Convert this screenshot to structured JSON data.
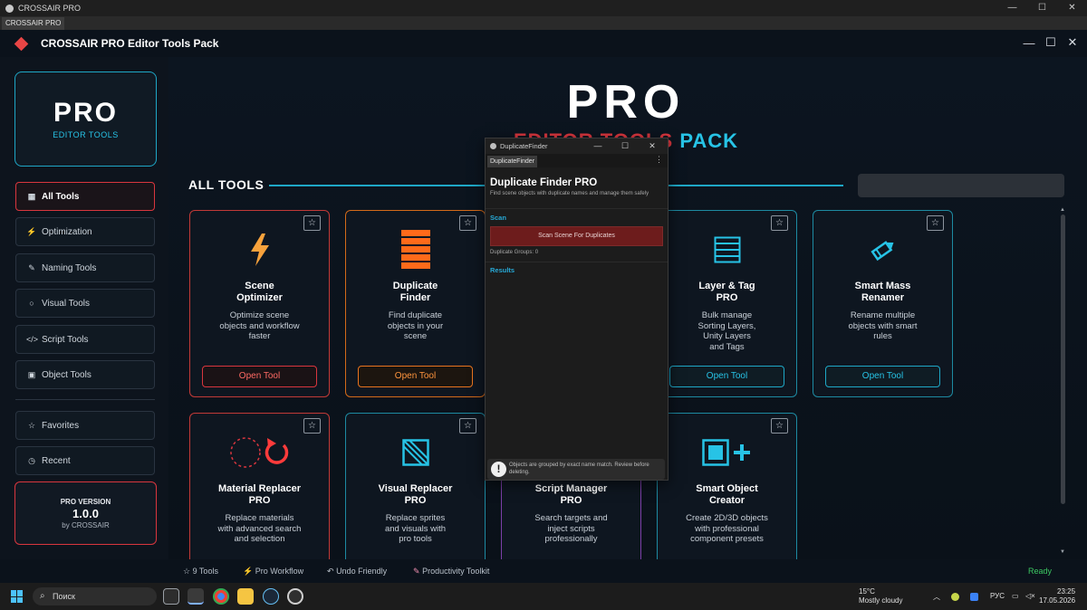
{
  "os_window": {
    "title": "CROSSAIR PRO",
    "tab": "CROSSAIR PRO",
    "controls": [
      "—",
      "☐",
      "✕"
    ]
  },
  "app": {
    "title": "CROSSAIR PRO Editor Tools Pack",
    "window_controls": [
      "—",
      "☐",
      "✕"
    ],
    "brand_color": "#e84545",
    "accent_color": "#27c3e6"
  },
  "sidebar": {
    "logo": {
      "title": "PRO",
      "subtitle": "EDITOR TOOLS"
    },
    "nav": [
      {
        "icon": "▦",
        "icon_name": "grid-icon",
        "label": "All Tools",
        "active": true
      },
      {
        "icon": "⚡",
        "icon_name": "bolt-icon",
        "label": "Optimization",
        "active": false
      },
      {
        "icon": "✎",
        "icon_name": "pencil-icon",
        "label": "Naming Tools",
        "active": false
      },
      {
        "icon": "○",
        "icon_name": "circle-icon",
        "label": "Visual Tools",
        "active": false
      },
      {
        "icon": "</>",
        "icon_name": "code-icon",
        "label": "Script Tools",
        "active": false
      },
      {
        "icon": "▣",
        "icon_name": "cube-icon",
        "label": "Object Tools",
        "active": false
      }
    ],
    "secondary": [
      {
        "icon": "☆",
        "icon_name": "star-icon",
        "label": "Favorites"
      },
      {
        "icon": "◷",
        "icon_name": "clock-icon",
        "label": "Recent"
      }
    ],
    "version": {
      "label": "PRO VERSION",
      "number": "1.0.0",
      "by": "by CROSSAIR"
    }
  },
  "hero": {
    "title": "PRO",
    "subtitle_part1": "EDITOR TOOLS",
    "subtitle_part2": "PACK"
  },
  "tools_section": {
    "heading": "ALL TOOLS",
    "search_value": ""
  },
  "cards": [
    {
      "icon_name": "bolt-icon",
      "title": "Scene\nOptimizer",
      "desc": "Optimize scene\nobjects and workflow\nfaster",
      "button": "Open Tool",
      "theme": "red",
      "star": "☆"
    },
    {
      "icon_name": "stack-icon",
      "title": "Duplicate\nFinder",
      "desc": "Find duplicate\nobjects in your\nscene",
      "button": "Open Tool",
      "theme": "orange",
      "star": "☆"
    },
    {
      "icon_name": "layers-icon",
      "title": "Layer & Tag\nPRO",
      "desc": "Bulk manage\nSorting Layers,\nUnity Layers\nand Tags",
      "button": "Open Tool",
      "theme": "cyan",
      "star": "☆"
    },
    {
      "icon_name": "pencil-icon",
      "title": "Smart Mass\nRenamer",
      "desc": "Rename multiple\nobjects with smart\nrules",
      "button": "Open Tool",
      "theme": "cyan",
      "star": "☆"
    },
    {
      "icon_name": "material-replace-icon",
      "title": "Material Replacer\nPRO",
      "desc": "Replace materials\nwith advanced search\nand selection",
      "button": "",
      "theme": "red",
      "star": "☆"
    },
    {
      "icon_name": "visual-replace-icon",
      "title": "Visual Replacer\nPRO",
      "desc": "Replace sprites\nand visuals with\npro tools",
      "button": "",
      "theme": "cyan",
      "star": "☆"
    },
    {
      "icon_name": "script-icon",
      "title": "Script Manager\nPRO",
      "desc": "Search targets and\ninject scripts\nprofessionally",
      "button": "",
      "theme": "purple",
      "star": ""
    },
    {
      "icon_name": "object-creator-icon",
      "title": "Smart Object\nCreator",
      "desc": "Create 2D/3D objects\nwith professional\ncomponent presets",
      "button": "",
      "theme": "cyan",
      "star": "☆"
    }
  ],
  "footer": {
    "items": [
      {
        "icon": "☆",
        "icon_name": "star-icon",
        "label": "9 Tools"
      },
      {
        "icon": "⚡",
        "icon_name": "bolt-icon",
        "label": "Pro Workflow"
      },
      {
        "icon": "↶",
        "icon_name": "undo-icon",
        "label": "Undo Friendly"
      },
      {
        "icon": "✎",
        "icon_name": "brush-icon",
        "label": "Productivity Toolkit"
      }
    ],
    "status": "Ready"
  },
  "duplicate_finder_window": {
    "window_title": "DuplicateFinder",
    "tab": "DuplicateFinder",
    "controls": [
      "—",
      "☐",
      "✕"
    ],
    "title": "Duplicate Finder PRO",
    "description": "Find scene objects with duplicate names and manage them safely",
    "scan_section": "Scan",
    "scan_button": "Scan Scene For Duplicates",
    "groups_label": "Duplicate Groups: 0",
    "results_section": "Results",
    "help_icon": "!",
    "help_text": "Objects are grouped by exact name match. Review before deleting."
  },
  "taskbar": {
    "search_placeholder": "Поиск",
    "weather_temp": "15°C",
    "weather_desc": "Mostly cloudy",
    "lang": "РУС",
    "time": "23:25",
    "date": "17.05.2026"
  }
}
